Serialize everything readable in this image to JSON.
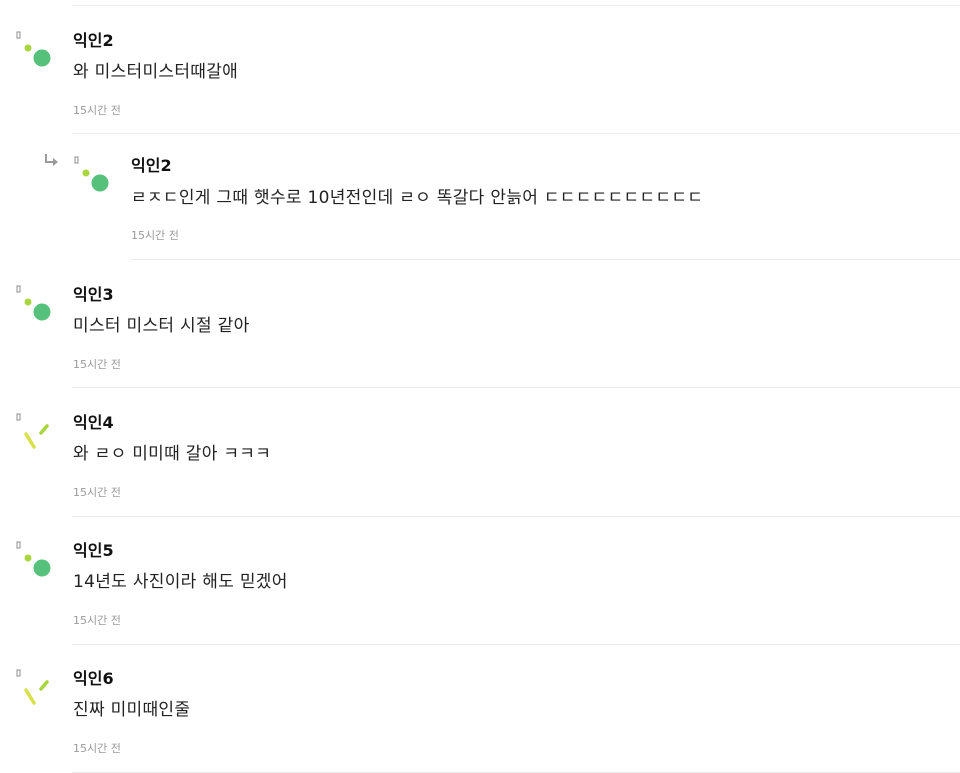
{
  "colors": {
    "avatar_green": "#56c17b",
    "avatar_lime": "#a7d63f",
    "avatar_yellow": "#d8e04a",
    "avatar_gray": "#8c8c8c",
    "author_text": "#111111",
    "content_text": "#222222",
    "time_text": "#9a9a9a",
    "divider": "#ececec"
  },
  "comments": [
    {
      "author": "익인2",
      "content": "와 미스터미스터때갈애",
      "time": "15시간 전",
      "avatar_icon": "dots-avatar-icon",
      "is_reply": false
    },
    {
      "author": "익인2",
      "content": "ㄹㅈㄷ인게 그때 햇수로 10년전인데 ㄹㅇ 똑갈다 안늙어 ㄷㄷㄷㄷㄷㄷㄷㄷㄷㄷ",
      "time": "15시간 전",
      "avatar_icon": "dots-avatar-icon",
      "is_reply": true,
      "reply_icon": "reply-arrow-icon"
    },
    {
      "author": "익인3",
      "content": "미스터 미스터 시절 같아",
      "time": "15시간 전",
      "avatar_icon": "dots-avatar-icon",
      "is_reply": false
    },
    {
      "author": "익인4",
      "content": "와 ㄹㅇ 미미때 갈아 ㅋㅋㅋ",
      "time": "15시간 전",
      "avatar_icon": "slash-avatar-icon",
      "is_reply": false
    },
    {
      "author": "익인5",
      "content": "14년도 사진이라 해도 믿겠어",
      "time": "15시간 전",
      "avatar_icon": "dots-avatar-icon",
      "is_reply": false
    },
    {
      "author": "익인6",
      "content": "진짜 미미때인줄",
      "time": "15시간 전",
      "avatar_icon": "slash-avatar-icon",
      "is_reply": false
    }
  ]
}
